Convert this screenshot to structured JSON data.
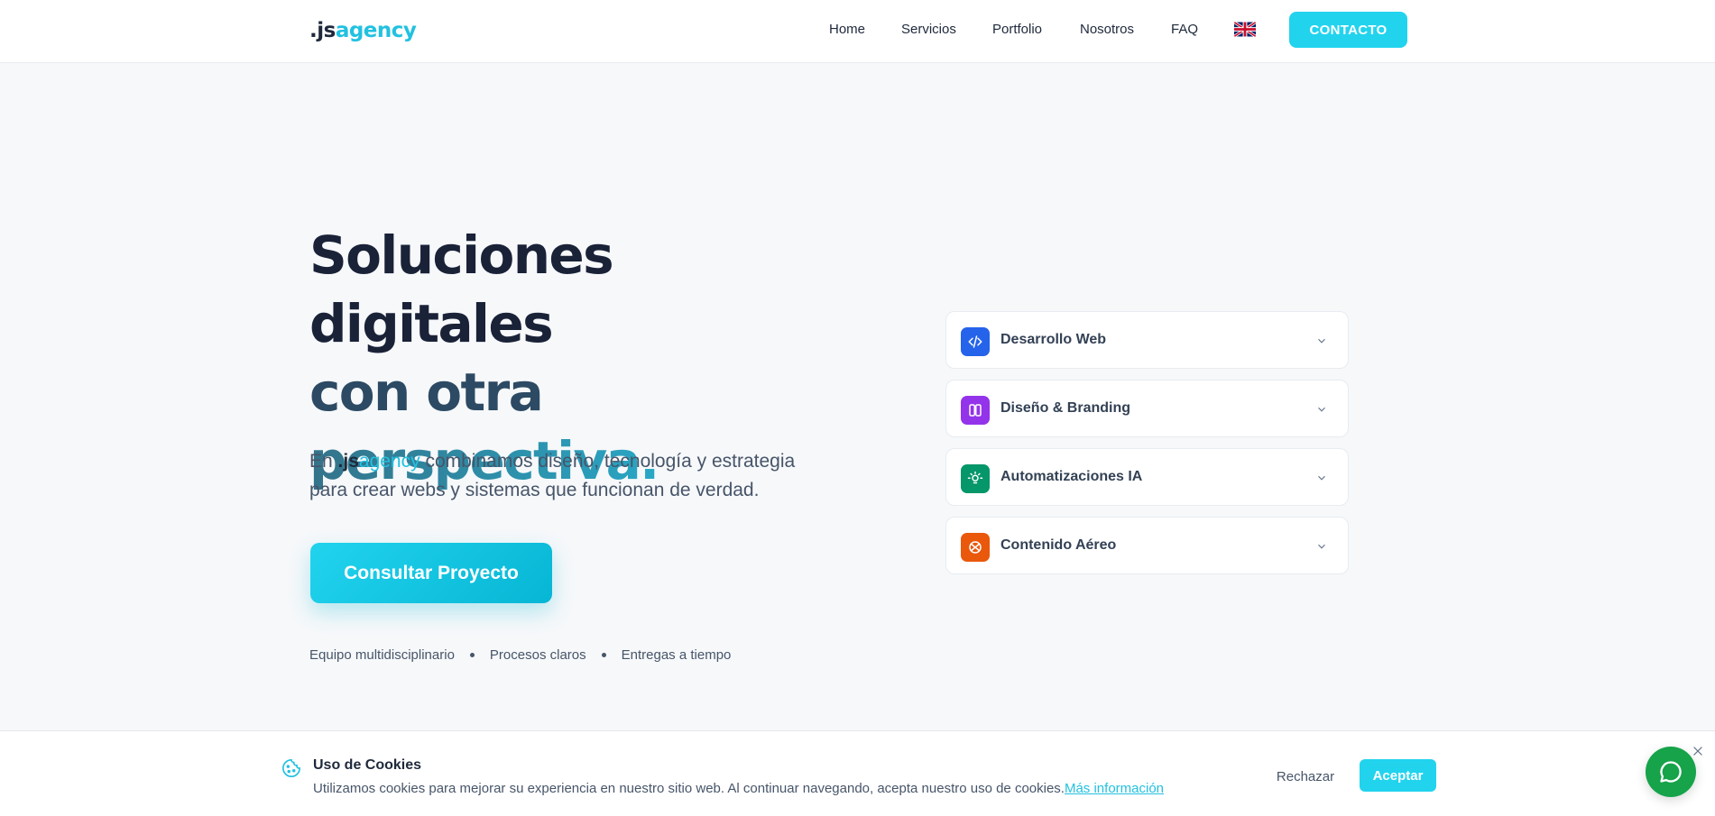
{
  "header": {
    "logo_part1": ".js",
    "logo_part2": "agency",
    "nav": [
      "Home",
      "Servicios",
      "Portfolio",
      "Nosotros",
      "FAQ"
    ],
    "language_flag_icon": "uk-flag-icon",
    "contact_label": "CONTACTO"
  },
  "hero": {
    "title_line1": "Soluciones digitales",
    "title_line2": "con otra",
    "title_line3": "perspectiva.",
    "desc_prefix": "En ",
    "desc_brand1": ".js",
    "desc_brand2": "agency",
    "desc_rest1": " combinamos diseño, tecnología y estrategia",
    "desc_rest2": "para crear webs y sistemas que funcionan de verdad.",
    "cta_label": "Consultar Proyecto",
    "features": [
      "Equipo multidisciplinario",
      "Procesos claros",
      "Entregas a tiempo"
    ]
  },
  "services": [
    {
      "label": "Desarrollo Web",
      "icon": "code-icon",
      "color": "#2563eb"
    },
    {
      "label": "Diseño & Branding",
      "icon": "columns-icon",
      "color": "#9333ea"
    },
    {
      "label": "Automatizaciones IA",
      "icon": "lightbulb-icon",
      "color": "#059669"
    },
    {
      "label": "Contenido Aéreo",
      "icon": "drone-icon",
      "color": "#ea580c"
    }
  ],
  "cookies": {
    "title": "Uso de Cookies",
    "text": "Utilizamos cookies para mejorar su experiencia en nuestro sitio web. Al continuar navegando, acepta nuestro uso de cookies.",
    "link": "Más información",
    "reject_label": "Rechazar",
    "accept_label": "Aceptar"
  },
  "colors": {
    "accent": "#22d3ee",
    "dark": "#1e293b",
    "chat_green": "#16a34a"
  }
}
